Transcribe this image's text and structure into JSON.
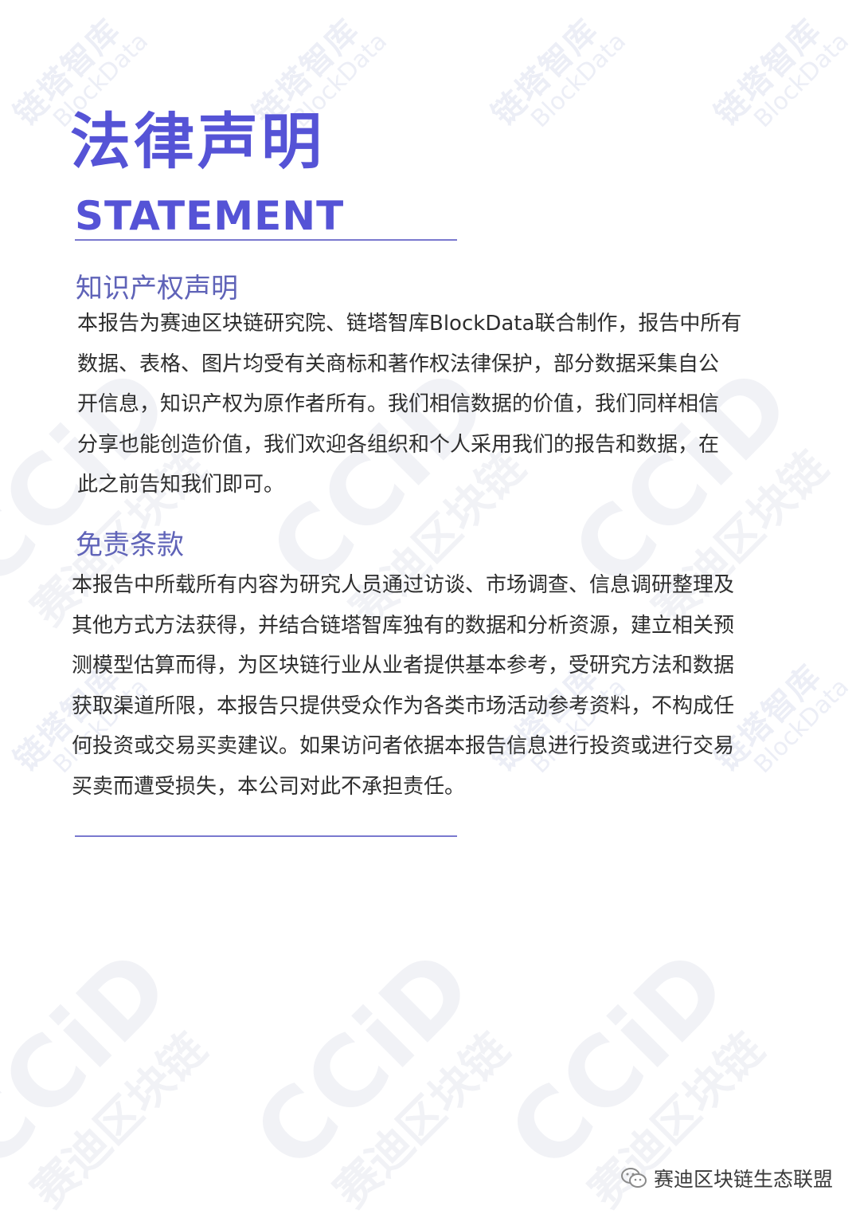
{
  "header": {
    "title_cn": "法律声明",
    "title_en": "STATEMENT"
  },
  "sections": [
    {
      "heading": "知识产权声明",
      "lines": [
        "本报告为赛迪区块链研究院、链塔智库BlockData联合制作，报告中所有",
        "数据、表格、图片均受有关商标和著作权法律保护，部分数据采集自公",
        "开信息，知识产权为原作者所有。我们相信数据的价值，我们同样相信",
        "分享也能创造价值，我们欢迎各组织和个人采用我们的报告和数据，在",
        "此之前告知我们即可。"
      ]
    },
    {
      "heading": "免责条款",
      "lines": [
        "本报告中所载所有内容为研究人员通过访谈、市场调查、信息调研整理及",
        "其他方式方法获得，并结合链塔智库独有的数据和分析资源，建立相关预",
        "测模型估算而得，为区块链行业从业者提供基本参考，受研究方法和数据",
        "获取渠道所限，本报告只提供受众作为各类市场活动参考资料，不构成任",
        "何投资或交易买卖建议。如果访问者依据本报告信息进行投资或进行交易",
        "买卖而遭受损失，本公司对此不承担责任。"
      ]
    }
  ],
  "watermarks": {
    "blockdata_cn": "链塔智库",
    "blockdata_en": "BlockData",
    "ccid_en": "CCiD",
    "ccid_cn": "赛迪区块链"
  },
  "footer": {
    "icon": "wechat-icon",
    "account_name": "赛迪区块链生态联盟"
  },
  "colors": {
    "accent": "#5553d6",
    "heading": "#5f63b8",
    "rule": "#7a79cf",
    "watermark": "#eceef6"
  }
}
